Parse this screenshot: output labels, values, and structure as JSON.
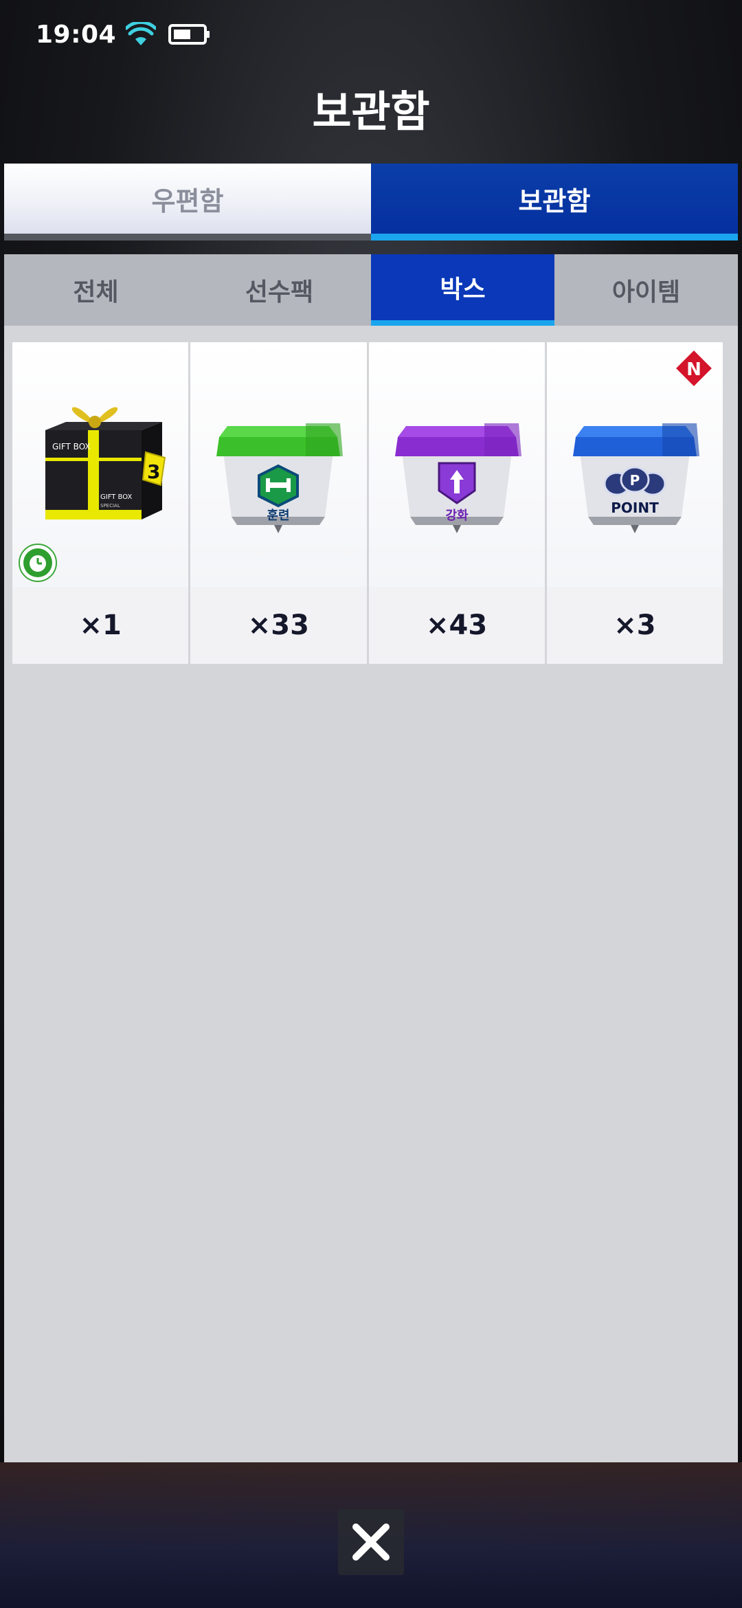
{
  "status_bar": {
    "time": "19:04"
  },
  "header": {
    "title": "보관함"
  },
  "top_tabs": [
    {
      "label": "우편함",
      "active": false
    },
    {
      "label": "보관함",
      "active": true
    }
  ],
  "sub_tabs": [
    {
      "label": "전체",
      "active": false
    },
    {
      "label": "선수팩",
      "active": false
    },
    {
      "label": "박스",
      "active": true
    },
    {
      "label": "아이템",
      "active": false
    }
  ],
  "items": [
    {
      "icon": "gift-box-special-icon",
      "count": "×1",
      "box_text": "GIFT BOX",
      "box_subtext": "SPECIAL",
      "tag_text": "3",
      "has_timer": true
    },
    {
      "icon": "training-box-icon",
      "count": "×33",
      "label": "훈련",
      "color": "#3bbf2a"
    },
    {
      "icon": "upgrade-box-icon",
      "count": "×43",
      "label": "강화",
      "color": "#9b3dd8"
    },
    {
      "icon": "point-box-icon",
      "count": "×3",
      "label": "POINT",
      "color": "#1f6de6",
      "badge": "N"
    }
  ],
  "colors": {
    "active_tab": "#0a38b8",
    "active_underline": "#1ba5ee",
    "panel_bg": "#d4d5d9"
  }
}
